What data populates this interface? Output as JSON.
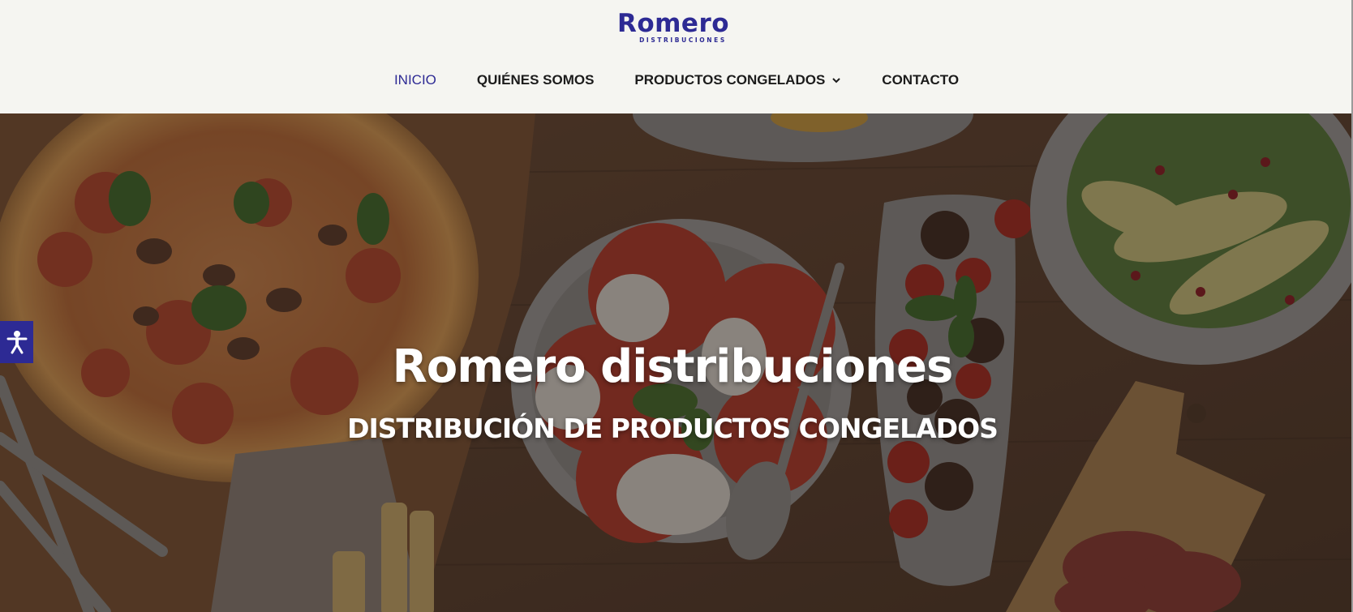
{
  "brand": {
    "name": "Romero",
    "tagline": "DISTRIBUCIONES",
    "color": "#2d2a94"
  },
  "nav": {
    "items": [
      {
        "label": "INICIO",
        "active": true
      },
      {
        "label": "QUIÉNES SOMOS",
        "active": false
      },
      {
        "label": "PRODUCTOS CONGELADOS",
        "active": false,
        "has_dropdown": true,
        "icon": "chevron-down-icon"
      },
      {
        "label": "CONTACTO",
        "active": false
      }
    ]
  },
  "hero": {
    "title": "Romero distribuciones",
    "subtitle": "DISTRIBUCIÓN DE PRODUCTOS CONGELADOS"
  },
  "accessibility": {
    "icon": "accessibility-icon",
    "color": "#2d2a94"
  }
}
